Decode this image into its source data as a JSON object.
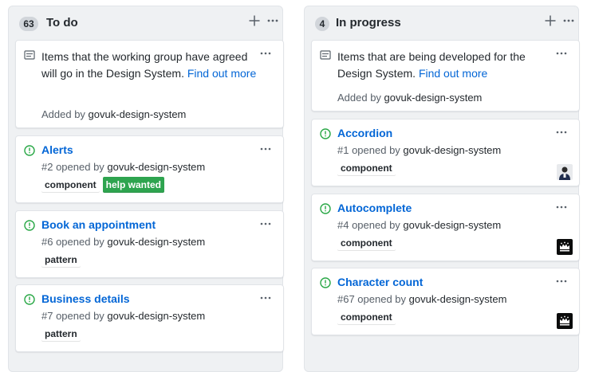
{
  "columns": {
    "todo": {
      "count": "63",
      "title": "To do",
      "note": {
        "text": "Items that the working group have agreed will go in the Design System.",
        "link": "Find out more",
        "added_by_prefix": "Added by ",
        "added_by_user": "govuk-design-system"
      },
      "cards": [
        {
          "title": "Alerts",
          "meta_prefix": "#2 opened by ",
          "user": "govuk-design-system",
          "labels": [
            "component",
            "help wanted"
          ]
        },
        {
          "title": "Book an appointment",
          "meta_prefix": "#6 opened by ",
          "user": "govuk-design-system",
          "labels": [
            "pattern"
          ]
        },
        {
          "title": "Business details",
          "meta_prefix": "#7 opened by ",
          "user": "govuk-design-system",
          "labels": [
            "pattern"
          ]
        }
      ]
    },
    "progress": {
      "count": "4",
      "title": "In progress",
      "note": {
        "text": "Items that are being developed for the Design System.",
        "link": "Find out more",
        "added_by_prefix": "Added by ",
        "added_by_user": "govuk-design-system"
      },
      "cards": [
        {
          "title": "Accordion",
          "meta_prefix": "#1 opened by ",
          "user": "govuk-design-system",
          "labels": [
            "component"
          ]
        },
        {
          "title": "Autocomplete",
          "meta_prefix": "#4 opened by ",
          "user": "govuk-design-system",
          "labels": [
            "component"
          ]
        },
        {
          "title": "Character count",
          "meta_prefix": "#67 opened by ",
          "user": "govuk-design-system",
          "labels": [
            "component"
          ]
        }
      ]
    }
  },
  "colors": {
    "link": "#0366d6",
    "open_issue_icon": "#28a745",
    "help_wanted_label": "#2ea44f",
    "column_bg": "#eff1f3"
  },
  "icons": {
    "note": "note-icon",
    "issue": "issue-opened-icon",
    "add": "plus-icon",
    "menu": "kebab-horizontal-icon"
  }
}
